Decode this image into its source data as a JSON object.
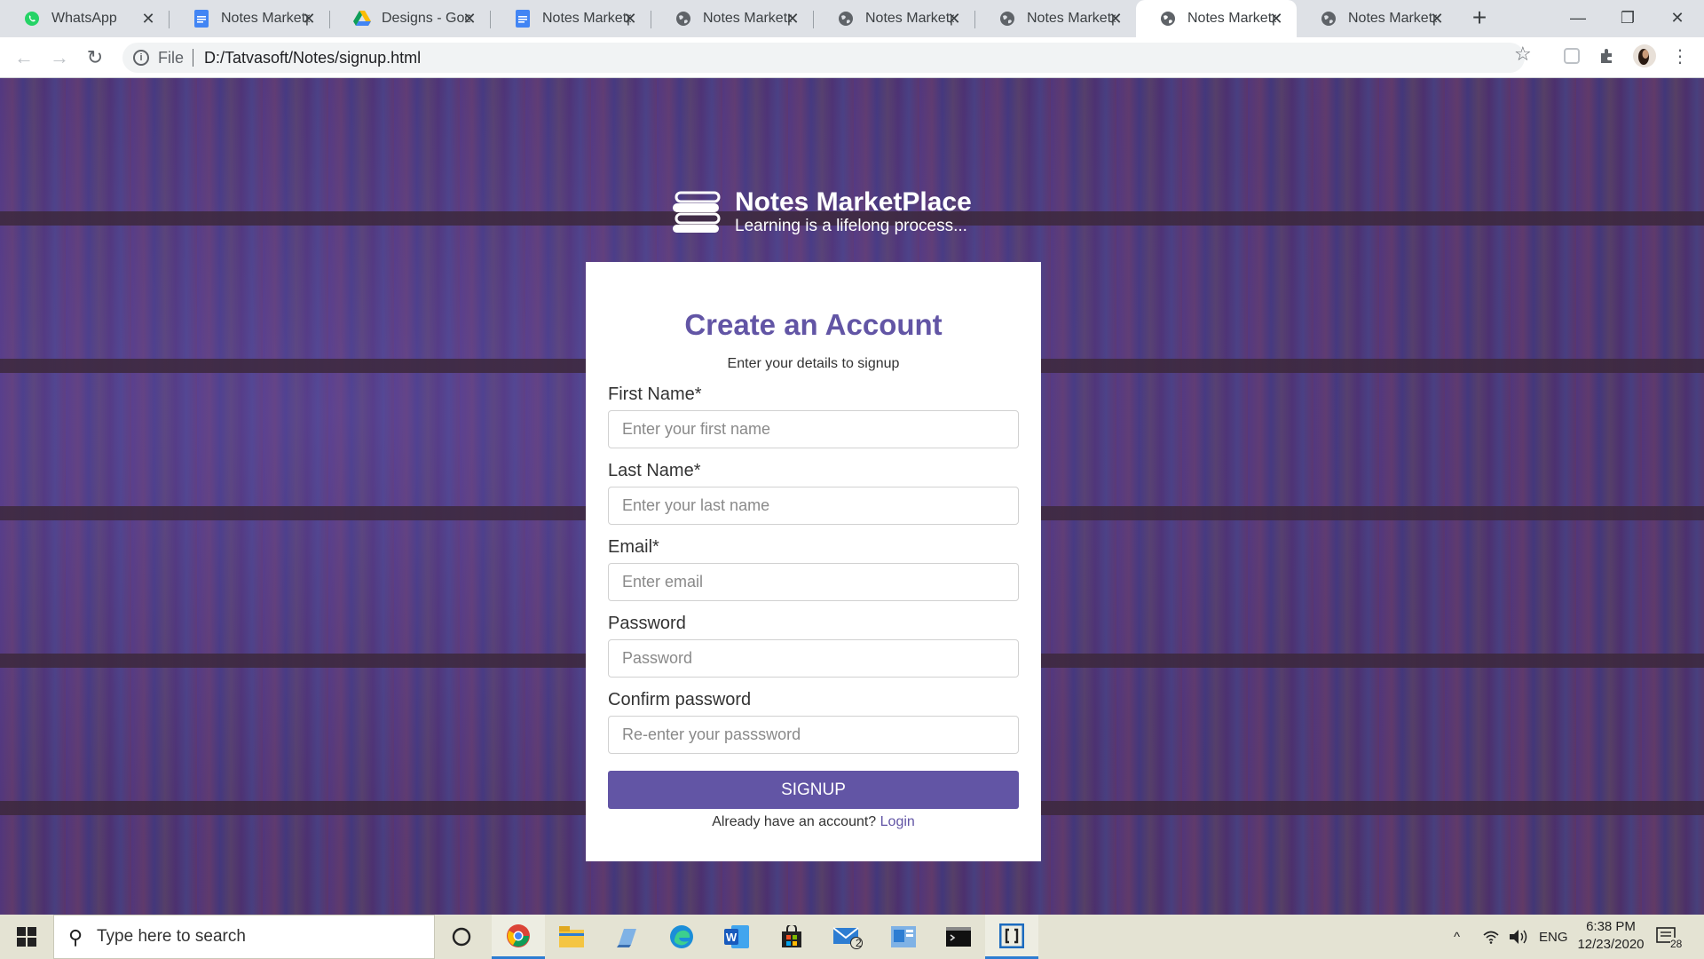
{
  "browser": {
    "tabs": [
      {
        "title": "WhatsApp",
        "icon": "whatsapp-icon",
        "color": "#25d366"
      },
      {
        "title": "Notes Marketp",
        "icon": "docs-icon",
        "color": "#4285f4"
      },
      {
        "title": "Designs - Goog",
        "icon": "drive-icon",
        "color": "#fbbc04"
      },
      {
        "title": "Notes Marketp",
        "icon": "docs-icon",
        "color": "#4285f4"
      },
      {
        "title": "Notes Marketp",
        "icon": "globe-icon",
        "color": "#5f6368"
      },
      {
        "title": "Notes Marketp",
        "icon": "globe-icon",
        "color": "#5f6368"
      },
      {
        "title": "Notes Marketp",
        "icon": "globe-icon",
        "color": "#5f6368"
      },
      {
        "title": "Notes Marketp",
        "icon": "globe-icon",
        "color": "#5f6368",
        "active": true
      },
      {
        "title": "Notes Marketp",
        "icon": "globe-icon",
        "color": "#5f6368"
      }
    ],
    "address": {
      "scheme": "File",
      "url": "D:/Tatvasoft/Notes/signup.html"
    }
  },
  "brand": {
    "title": "Notes MarketPlace",
    "tagline": "Learning is a lifelong process..."
  },
  "form": {
    "heading": "Create an Account",
    "subtitle": "Enter your details to signup",
    "first_name": {
      "label": "First Name*",
      "placeholder": "Enter your first name"
    },
    "last_name": {
      "label": "Last Name*",
      "placeholder": "Enter your last name"
    },
    "email": {
      "label": "Email*",
      "placeholder": "Enter email"
    },
    "password": {
      "label": "Password",
      "placeholder": "Password"
    },
    "confirm_password": {
      "label": "Confirm password",
      "placeholder": "Re-enter your passsword"
    },
    "submit_label": "SIGNUP",
    "login_prompt": "Already have an account?",
    "login_link": "Login"
  },
  "theme": {
    "accent": "#6255a5"
  },
  "taskbar": {
    "search_placeholder": "Type here to search",
    "mail_badge": "2",
    "language": "ENG",
    "time": "6:38 PM",
    "date": "12/23/2020",
    "notification_count": "28"
  }
}
